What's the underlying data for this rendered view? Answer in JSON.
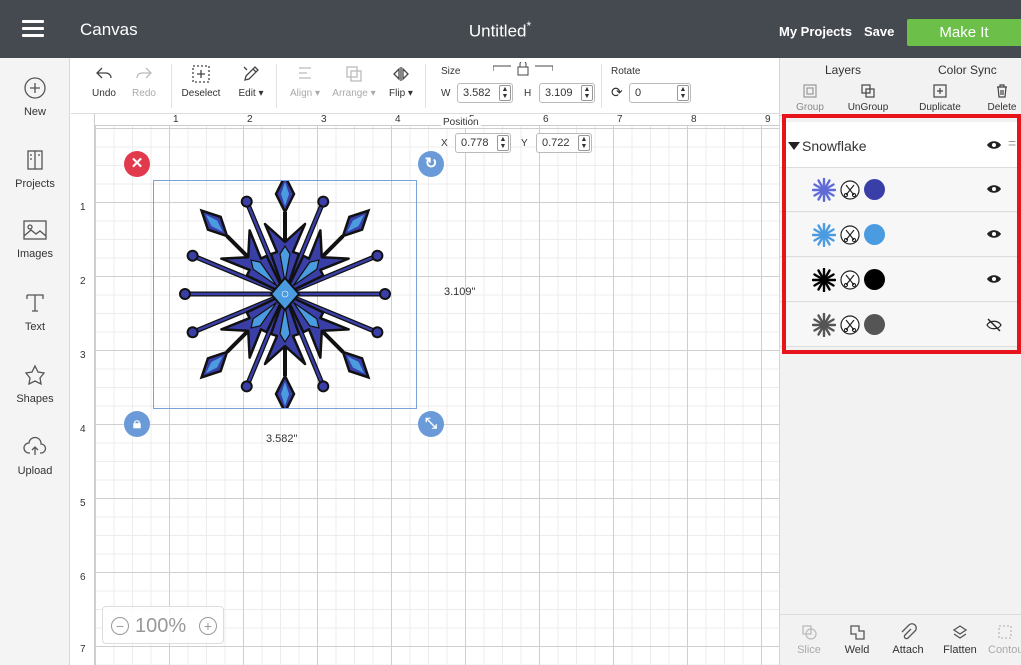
{
  "header": {
    "app_title": "Canvas",
    "doc_title": "Untitled",
    "unsaved_mark": "*",
    "my_projects": "My Projects",
    "save": "Save",
    "make_it": "Make It"
  },
  "sidebar": {
    "items": [
      {
        "label": "New",
        "icon": "plus-circle-icon"
      },
      {
        "label": "Projects",
        "icon": "projects-icon"
      },
      {
        "label": "Images",
        "icon": "image-icon"
      },
      {
        "label": "Text",
        "icon": "text-icon"
      },
      {
        "label": "Shapes",
        "icon": "shapes-icon"
      },
      {
        "label": "Upload",
        "icon": "upload-icon"
      }
    ]
  },
  "toolbar": {
    "undo": "Undo",
    "redo": "Redo",
    "deselect": "Deselect",
    "edit": "Edit",
    "align": "Align",
    "arrange": "Arrange",
    "flip": "Flip",
    "size_label": "Size",
    "w_label": "W",
    "w_value": "3.582",
    "h_label": "H",
    "h_value": "3.109",
    "rotate_label": "Rotate",
    "rotate_value": "0",
    "position_label": "Position",
    "x_label": "X",
    "x_value": "0.778",
    "y_label": "Y",
    "y_value": "0.722"
  },
  "ruler": {
    "h": [
      "1",
      "2",
      "3",
      "4",
      "5",
      "6",
      "7",
      "8",
      "9"
    ],
    "v": [
      "1",
      "2",
      "3",
      "4",
      "5",
      "6",
      "7"
    ]
  },
  "canvas": {
    "height_label": "3.109\"",
    "width_label": "3.582\"",
    "zoom": "100%"
  },
  "panel": {
    "tabs": [
      "Layers",
      "Color Sync"
    ],
    "layer_tools": [
      "Group",
      "UnGroup",
      "Duplicate",
      "Delete"
    ],
    "group_name": "Snowflake",
    "layers": [
      {
        "color": "#3a3fa8",
        "fill": "#5f6bd6",
        "hidden": false
      },
      {
        "color": "#4a9be0",
        "fill": "#4a9be0",
        "hidden": false
      },
      {
        "color": "#000000",
        "fill": "#000000",
        "hidden": false
      },
      {
        "color": "#555555",
        "fill": "#555555",
        "hidden": true
      }
    ],
    "bottom_tools": [
      "Slice",
      "Weld",
      "Attach",
      "Flatten",
      "Contour"
    ]
  },
  "colors": {
    "topbar": "#444a4f",
    "make_it": "#6cc04a",
    "highlight": "#e8141c",
    "selection": "#7aa2d6"
  }
}
